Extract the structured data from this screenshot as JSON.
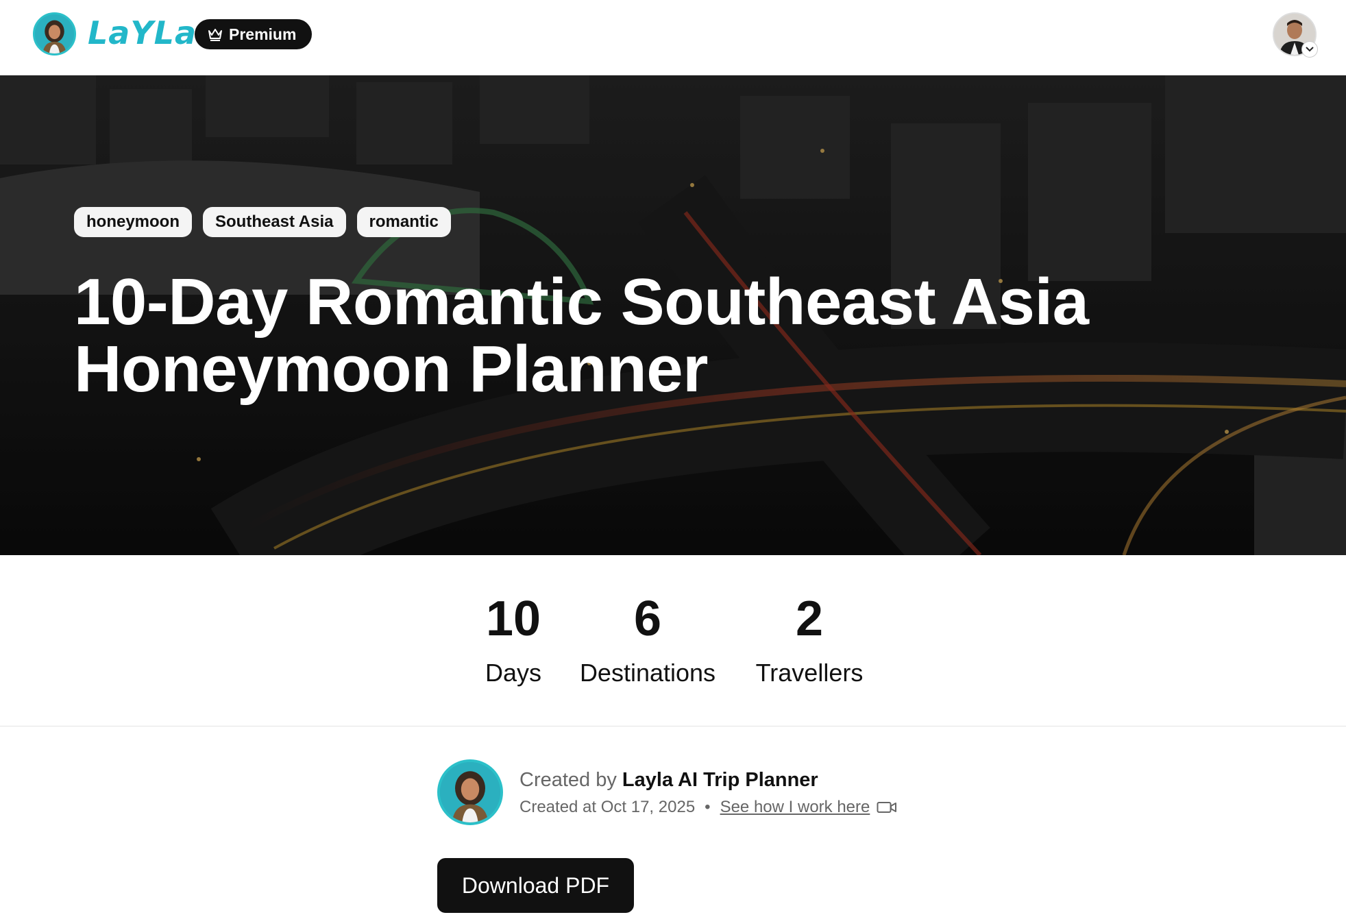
{
  "header": {
    "logo_text": "LaYLa",
    "premium_label": "Premium"
  },
  "hero": {
    "tags": [
      "honeymoon",
      "Southeast Asia",
      "romantic"
    ],
    "title": "10-Day Romantic Southeast Asia Honeymoon Planner"
  },
  "stats": [
    {
      "value": "10",
      "label": "Days"
    },
    {
      "value": "6",
      "label": "Destinations"
    },
    {
      "value": "2",
      "label": "Travellers"
    }
  ],
  "author": {
    "created_by_prefix": "Created by",
    "name": "Layla AI Trip Planner",
    "created_at": "Created at Oct 17, 2025",
    "separator": "•",
    "how_link": "See how I work here"
  },
  "actions": {
    "download_label": "Download PDF"
  },
  "colors": {
    "brand": "#22b7c9",
    "button_dark": "#111111",
    "hero_overlay": "#151515"
  },
  "icons": [
    "crown-icon",
    "chevron-down-icon",
    "video-icon"
  ]
}
